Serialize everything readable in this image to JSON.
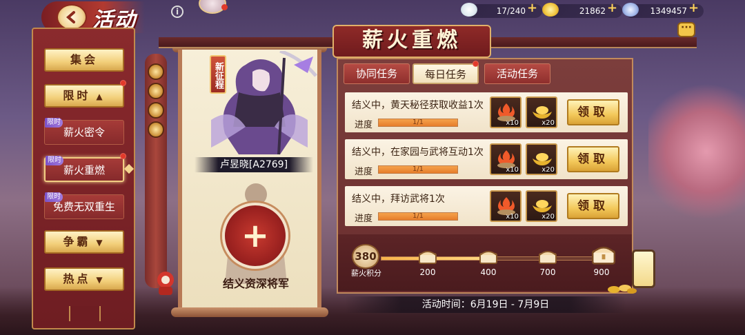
{
  "header": {
    "title": "活动",
    "info_glyph": "i"
  },
  "resources": [
    {
      "icon": "stamina-bun-icon",
      "value": "17/240"
    },
    {
      "icon": "gold-ingot-icon",
      "value": "21862"
    },
    {
      "icon": "jade-coin-icon",
      "value": "1349457"
    }
  ],
  "sidebar": {
    "items": [
      {
        "label": "集会",
        "style": "gold"
      },
      {
        "label": "限时",
        "style": "gold",
        "expanded": true,
        "badge_dot": true
      },
      {
        "label": "薪火密令",
        "style": "red",
        "tag": "限时"
      },
      {
        "label": "薪火重燃",
        "style": "red",
        "tag": "限时",
        "active": true,
        "badge_dot": true
      },
      {
        "label": "免费无双重生",
        "style": "red",
        "tag": "限时"
      },
      {
        "label": "争霸",
        "style": "gold"
      },
      {
        "label": "热点",
        "style": "gold"
      }
    ]
  },
  "event": {
    "title": "薪火重燃",
    "new_badge": "新征程",
    "hero_name": "卢昱晓[A2769]",
    "recruit_label": "结义资深将军",
    "tabs": [
      {
        "label": "协同任务",
        "active": false
      },
      {
        "label": "每日任务",
        "active": true,
        "badge_dot": true
      },
      {
        "label": "活动任务",
        "active": false
      }
    ],
    "tasks": [
      {
        "title": "结义中，黄天秘径获取收益1次",
        "progress_label": "进度",
        "progress_text": "1/1",
        "progress": 1.0,
        "rewards": [
          {
            "icon": "fire-bowl-icon",
            "count": "x10"
          },
          {
            "icon": "gold-ingot-icon",
            "count": "x20"
          }
        ],
        "claim": "领取"
      },
      {
        "title": "结义中，在家园与武将互动1次",
        "progress_label": "进度",
        "progress_text": "1/1",
        "progress": 1.0,
        "rewards": [
          {
            "icon": "fire-bowl-icon",
            "count": "x10"
          },
          {
            "icon": "gold-ingot-icon",
            "count": "x20"
          }
        ],
        "claim": "领取"
      },
      {
        "title": "结义中，拜访武将1次",
        "progress_label": "进度",
        "progress_text": "1/1",
        "progress": 1.0,
        "rewards": [
          {
            "icon": "fire-bowl-icon",
            "count": "x10"
          },
          {
            "icon": "gold-ingot-icon",
            "count": "x20"
          }
        ],
        "claim": "领取"
      }
    ],
    "score": {
      "value": "380",
      "label": "薪火积分",
      "current": 380
    },
    "milestones": [
      {
        "value": "200"
      },
      {
        "value": "400"
      },
      {
        "value": "700"
      },
      {
        "value": "900"
      }
    ],
    "duration": "活动时间：6月19日 - 7月9日"
  },
  "colors": {
    "accent_red": "#8f2a28",
    "gold": "#f3c85a",
    "progress": "#e67d2b",
    "tag_purple": "#8b62d0"
  }
}
